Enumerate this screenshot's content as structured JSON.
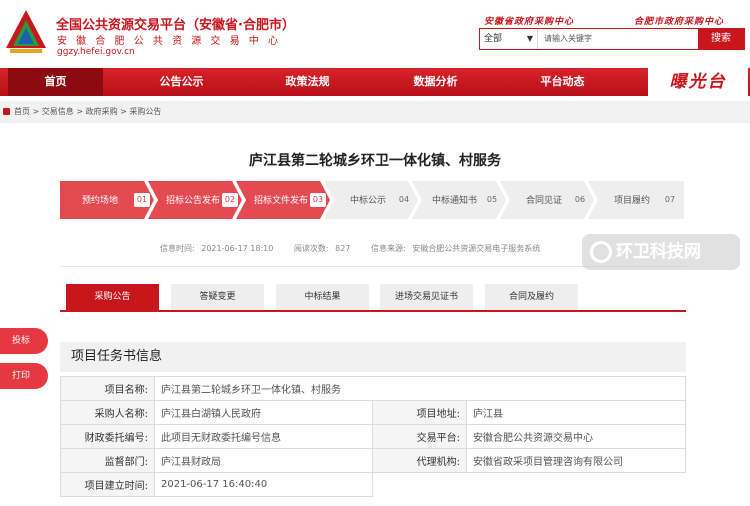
{
  "header": {
    "site_title": "全国公共资源交易平台（安徽省·合肥市）",
    "site_subtitle": "安 徽 合 肥 公 共 资 源 交 易 中 心",
    "site_url": "ggzy.hefei.gov.cn",
    "link_left": "安徽省政府采购中心",
    "link_right": "合肥市政府采购中心",
    "search": {
      "scope": "全部",
      "placeholder": "请输入关键字",
      "button": "搜索"
    }
  },
  "nav": {
    "items": [
      "首页",
      "公告公示",
      "政策法规",
      "数据分析",
      "平台动态"
    ],
    "logo_text": "曝光台"
  },
  "breadcrumb": [
    "首页",
    "交易信息",
    "政府采购",
    "采购公告"
  ],
  "page_title": "庐江县第二轮城乡环卫一体化镇、村服务",
  "steps": [
    {
      "label": "预约场地",
      "num": "01",
      "done": true
    },
    {
      "label": "招标公告发布",
      "num": "02",
      "done": true
    },
    {
      "label": "招标文件发布",
      "num": "03",
      "done": true
    },
    {
      "label": "中标公示",
      "num": "04",
      "done": false
    },
    {
      "label": "中标通知书",
      "num": "05",
      "done": false
    },
    {
      "label": "合同见证",
      "num": "06",
      "done": false
    },
    {
      "label": "项目履约",
      "num": "07",
      "done": false
    }
  ],
  "info": {
    "time_label": "信息时间:",
    "time_value": "2021-06-17 18:10",
    "views_label": "阅读次数:",
    "views_value": "827",
    "source_label": "信息来源:",
    "source_value": "安徽合肥公共资源交易电子服务系统"
  },
  "watermark": "环卫科技网",
  "tabs": [
    "采购公告",
    "答疑变更",
    "中标结果",
    "进场交易见证书",
    "合同及履约"
  ],
  "side_buttons": [
    "投标",
    "打印"
  ],
  "section_title": "项目任务书信息",
  "table": {
    "project_name_label": "项目名称:",
    "project_name": "庐江县第二轮城乡环卫一体化镇、村服务",
    "purchaser_label": "采购人名称:",
    "purchaser": "庐江县白湖镇人民政府",
    "address_label": "项目地址:",
    "address": "庐江县",
    "finance_label": "财政委托编号:",
    "finance": "此项目无财政委托编号信息",
    "platform_label": "交易平台:",
    "platform": "安徽合肥公共资源交易中心",
    "supervisor_label": "监督部门:",
    "supervisor": "庐江县财政局",
    "agent_label": "代理机构:",
    "agent": "安徽省政采项目管理咨询有限公司",
    "created_label": "项目建立时间:",
    "created": "2021-06-17 16:40:40"
  },
  "colors": {
    "brand_red": "#c8161d",
    "step_done": "#e34a52",
    "step_todo": "#eeeeee"
  }
}
